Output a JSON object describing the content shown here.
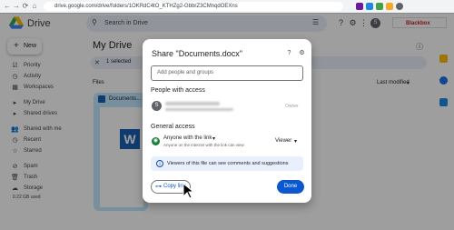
{
  "browser": {
    "url": "drive.google.com/drive/folders/1OKRdC4tO_KTHZg2-GbbrZ3CMnqdOEXns",
    "back": "←",
    "forward": "→",
    "reload": "⟳",
    "home": "⌂"
  },
  "drive": {
    "app_name": "Drive",
    "search_placeholder": "Search in Drive",
    "new_label": "New",
    "brand_text": "Blackbox",
    "user_initial": "S",
    "storage": "0.22 GB used",
    "sidebar": [
      {
        "label": "Priority",
        "icon": "☑"
      },
      {
        "label": "Activity",
        "icon": "◷"
      },
      {
        "label": "Workspaces",
        "icon": "▦"
      },
      {
        "label": "My Drive",
        "icon": "▸"
      },
      {
        "label": "Shared drives",
        "icon": "▸"
      },
      {
        "label": "Shared with me",
        "icon": "👥"
      },
      {
        "label": "Recent",
        "icon": "◷"
      },
      {
        "label": "Starred",
        "icon": "☆"
      },
      {
        "label": "Spam",
        "icon": "⊘"
      },
      {
        "label": "Trash",
        "icon": "🗑"
      },
      {
        "label": "Storage",
        "icon": "☁"
      }
    ],
    "page_title": "My Drive",
    "selected_count": "1 selected",
    "files_label": "Files",
    "sort_label": "Last modified",
    "file_name": "Documents..."
  },
  "dialog": {
    "title": "Share \"Documents.docx\"",
    "add_placeholder": "Add people and groups",
    "people_heading": "People with access",
    "person_initial": "S",
    "owner_label": "Owner",
    "general_heading": "General access",
    "access_value": "Anyone with the link",
    "access_desc": "Anyone on the internet with the link can view",
    "role_value": "Viewer",
    "info_text": "Viewers of this file can see comments and suggestions",
    "copy_link": "Copy link",
    "done": "Done"
  },
  "colors": {
    "primary": "#0b57d0",
    "selection": "#c2e7ff"
  }
}
